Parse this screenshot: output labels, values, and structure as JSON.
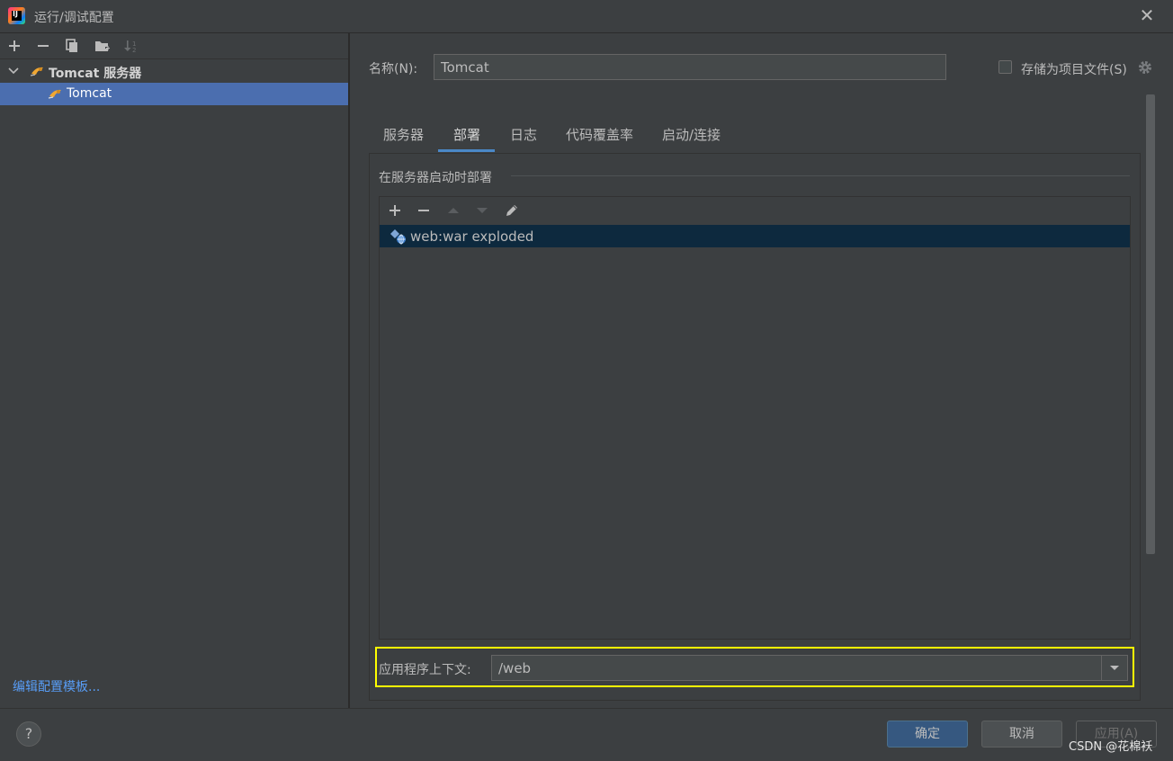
{
  "window": {
    "title": "运行/调试配置",
    "close_symbol": "✕"
  },
  "left": {
    "tree": {
      "group_label": "Tomcat 服务器",
      "item_label": "Tomcat"
    },
    "edit_templates_link": "编辑配置模板..."
  },
  "form": {
    "name_label": "名称(N):",
    "name_value": "Tomcat",
    "store_as_project_file_label": "存储为项目文件(S)",
    "store_as_project_file_checked": false
  },
  "tabs": [
    {
      "label": "服务器"
    },
    {
      "label": "部署",
      "active": true
    },
    {
      "label": "日志"
    },
    {
      "label": "代码覆盖率"
    },
    {
      "label": "启动/连接"
    }
  ],
  "deploy": {
    "section_title": "在服务器启动时部署",
    "artifacts": [
      "web:war exploded"
    ],
    "app_context_label": "应用程序上下文:",
    "app_context_value": "/web"
  },
  "buttons": {
    "help": "?",
    "ok": "确定",
    "cancel": "取消",
    "apply": "应用(A)"
  },
  "watermark": "CSDN @花棉袄",
  "colors": {
    "background": "#3c3f41",
    "selection": "#4b6eaf",
    "deploy_selection": "#0d293e",
    "accent_tab": "#4a88c7",
    "highlight": "#ffff00",
    "link": "#589df6"
  }
}
